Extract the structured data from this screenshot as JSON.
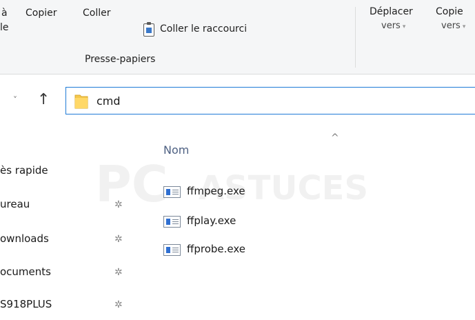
{
  "ribbon": {
    "left_fragment_top": "à",
    "left_fragment_bottom": "le",
    "copy_label": "Copier",
    "paste_label": "Coller",
    "paste_shortcut_label": "Coller le raccourci",
    "group_label": "Presse-papiers",
    "move_label": "Déplacer",
    "move_sub": "vers",
    "copy_to_label": "Copie",
    "copy_to_sub": "vers",
    "dropdown_glyph": "▾"
  },
  "address": {
    "back_glyph": "˅",
    "up_glyph": "↑",
    "path": "cmd"
  },
  "nav": {
    "items": [
      {
        "label": "ès rapide",
        "pinned": false
      },
      {
        "label": "ureau",
        "pinned": true
      },
      {
        "label": "ownloads",
        "pinned": true
      },
      {
        "label": "ocuments",
        "pinned": true
      },
      {
        "label": "S918PLUS",
        "pinned": true
      }
    ],
    "pin_glyph": "✲"
  },
  "list": {
    "column_name": "Nom",
    "sort_glyph": "^",
    "files": [
      {
        "name": "ffmpeg.exe"
      },
      {
        "name": "ffplay.exe"
      },
      {
        "name": "ffprobe.exe"
      }
    ]
  },
  "watermark": {
    "prefix": "PC",
    "suffix": "ASTUCES"
  },
  "colors": {
    "accent": "#1e7ad6",
    "header_text": "#4d6082",
    "folder": "#f5c84c",
    "exe_blue": "#2f6fd1"
  }
}
